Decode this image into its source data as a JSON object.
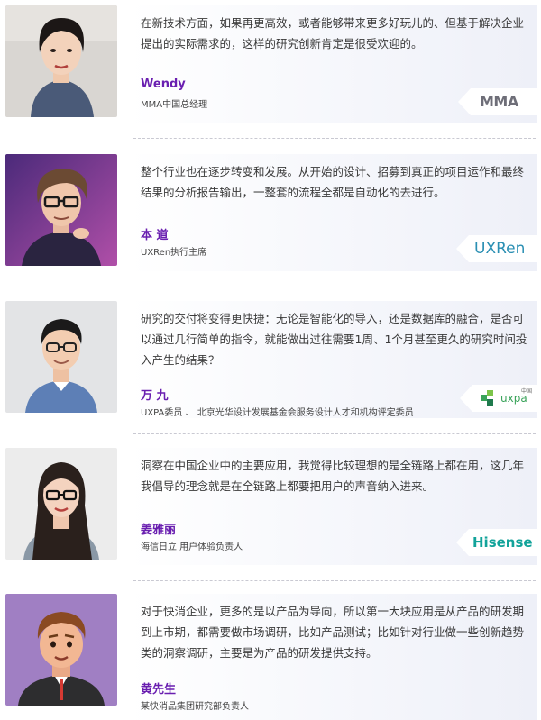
{
  "profiles": [
    {
      "quote": "在新技术方面，如果再更高效，或者能够带来更多好玩儿的、但基于解决企业提出的实际需求的，这样的研究创新肯定是很受欢迎的。",
      "name": "Wendy",
      "role": "MMA中国总经理",
      "logo": "MMA",
      "avatar": "portrait-woman-photo"
    },
    {
      "quote": "整个行业也在逐步转变和发展。从开始的设计、招募到真正的项目运作和最终结果的分析报告输出，一整套的流程全都是自动化的去进行。",
      "name": "本 道",
      "role": "UXRen执行主席",
      "logo": "UXRen",
      "avatar": "illustrated-man-portrait"
    },
    {
      "quote": "研究的交付将变得更快捷：无论是智能化的导入，还是数据库的融合，是否可以通过几行简单的指令，就能做出过往需要1周、1个月甚至更久的研究时间投入产生的结果？",
      "name": "万 九",
      "role": "UXPA委员 、 北京光华设计发展基金会服务设计人才和机构评定委员",
      "logo": "uxpa",
      "logo_sub": "中国",
      "avatar": "portrait-man-photo"
    },
    {
      "quote": "洞察在中国企业中的主要应用，我觉得比较理想的是全链路上都在用，这几年我倡导的理念就是在全链路上都要把用户的声音纳入进来。",
      "name": "姜雅丽",
      "role": "海信日立 用户体验负责人",
      "logo": "Hisense",
      "avatar": "portrait-woman-glasses-photo"
    },
    {
      "quote": "对于快消企业，更多的是以产品为导向，所以第一大块应用是从产品的研发期到上市期，都需要做市场调研，比如产品测试；比如针对行业做一些创新趋势类的洞察调研，主要是为产品的研发提供支持。",
      "name": "黄先生",
      "role": "某快消品集团研究部负责人",
      "logo": "",
      "avatar": "cartoon-man-avatar"
    }
  ],
  "colors": {
    "name": "#6a1fb0",
    "uxren_logo": "#2a8fb3",
    "hisense_logo": "#12a39a",
    "mma_logo": "#6e6e78"
  }
}
